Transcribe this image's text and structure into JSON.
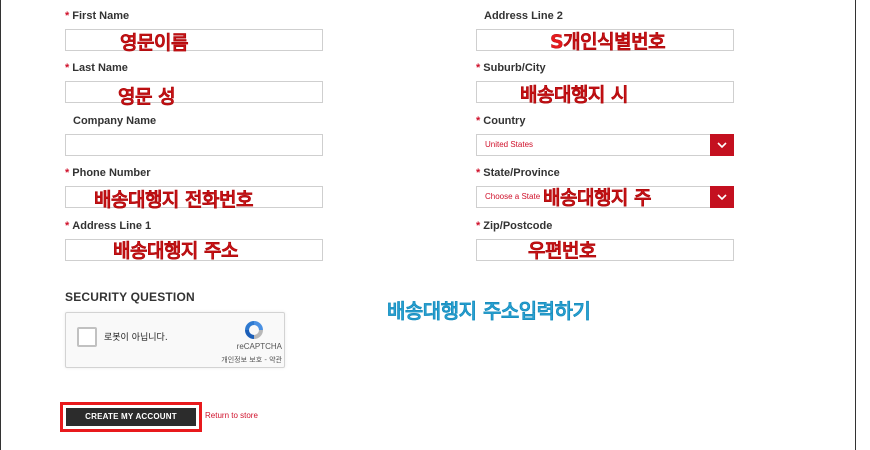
{
  "form": {
    "left": [
      {
        "key": "first_name",
        "label": "First Name",
        "required": true,
        "value": ""
      },
      {
        "key": "last_name",
        "label": "Last Name",
        "required": true,
        "value": ""
      },
      {
        "key": "company",
        "label": "Company Name",
        "required": false,
        "value": ""
      },
      {
        "key": "phone",
        "label": "Phone Number",
        "required": true,
        "value": ""
      },
      {
        "key": "address1",
        "label": "Address Line 1",
        "required": true,
        "value": ""
      }
    ],
    "right": [
      {
        "key": "address2",
        "label": "Address Line 2",
        "required": false,
        "value": ""
      },
      {
        "key": "city",
        "label": "Suburb/City",
        "required": true,
        "value": ""
      },
      {
        "key": "country",
        "label": "Country",
        "required": true,
        "selected": "United States"
      },
      {
        "key": "state",
        "label": "State/Province",
        "required": true,
        "selected": "Choose a State"
      },
      {
        "key": "zip",
        "label": "Zip/Postcode",
        "required": true,
        "value": ""
      }
    ],
    "required_mark": "*"
  },
  "annotations": {
    "first_name": "영문이름",
    "last_name": "영문 성",
    "phone": "배송대행지 전화번호",
    "address1": "배송대행지 주소",
    "address2": "S개인식별번호",
    "city": "배송대행지 시",
    "state": "배송대행지 주",
    "zip": "우편번호",
    "main": "배송대행지 주소입력하기"
  },
  "security": {
    "heading": "SECURITY QUESTION",
    "captcha_label": "로봇이 아닙니다.",
    "captcha_brand": "reCAPTCHA",
    "captcha_links": "개인정보 보호 - 약관"
  },
  "actions": {
    "create_label": "CREATE MY ACCOUNT",
    "return_label": "Return to store"
  },
  "colors": {
    "accent": "#c4101f",
    "annotation_red": "#e8191c",
    "annotation_blue": "#2fb0e2"
  }
}
